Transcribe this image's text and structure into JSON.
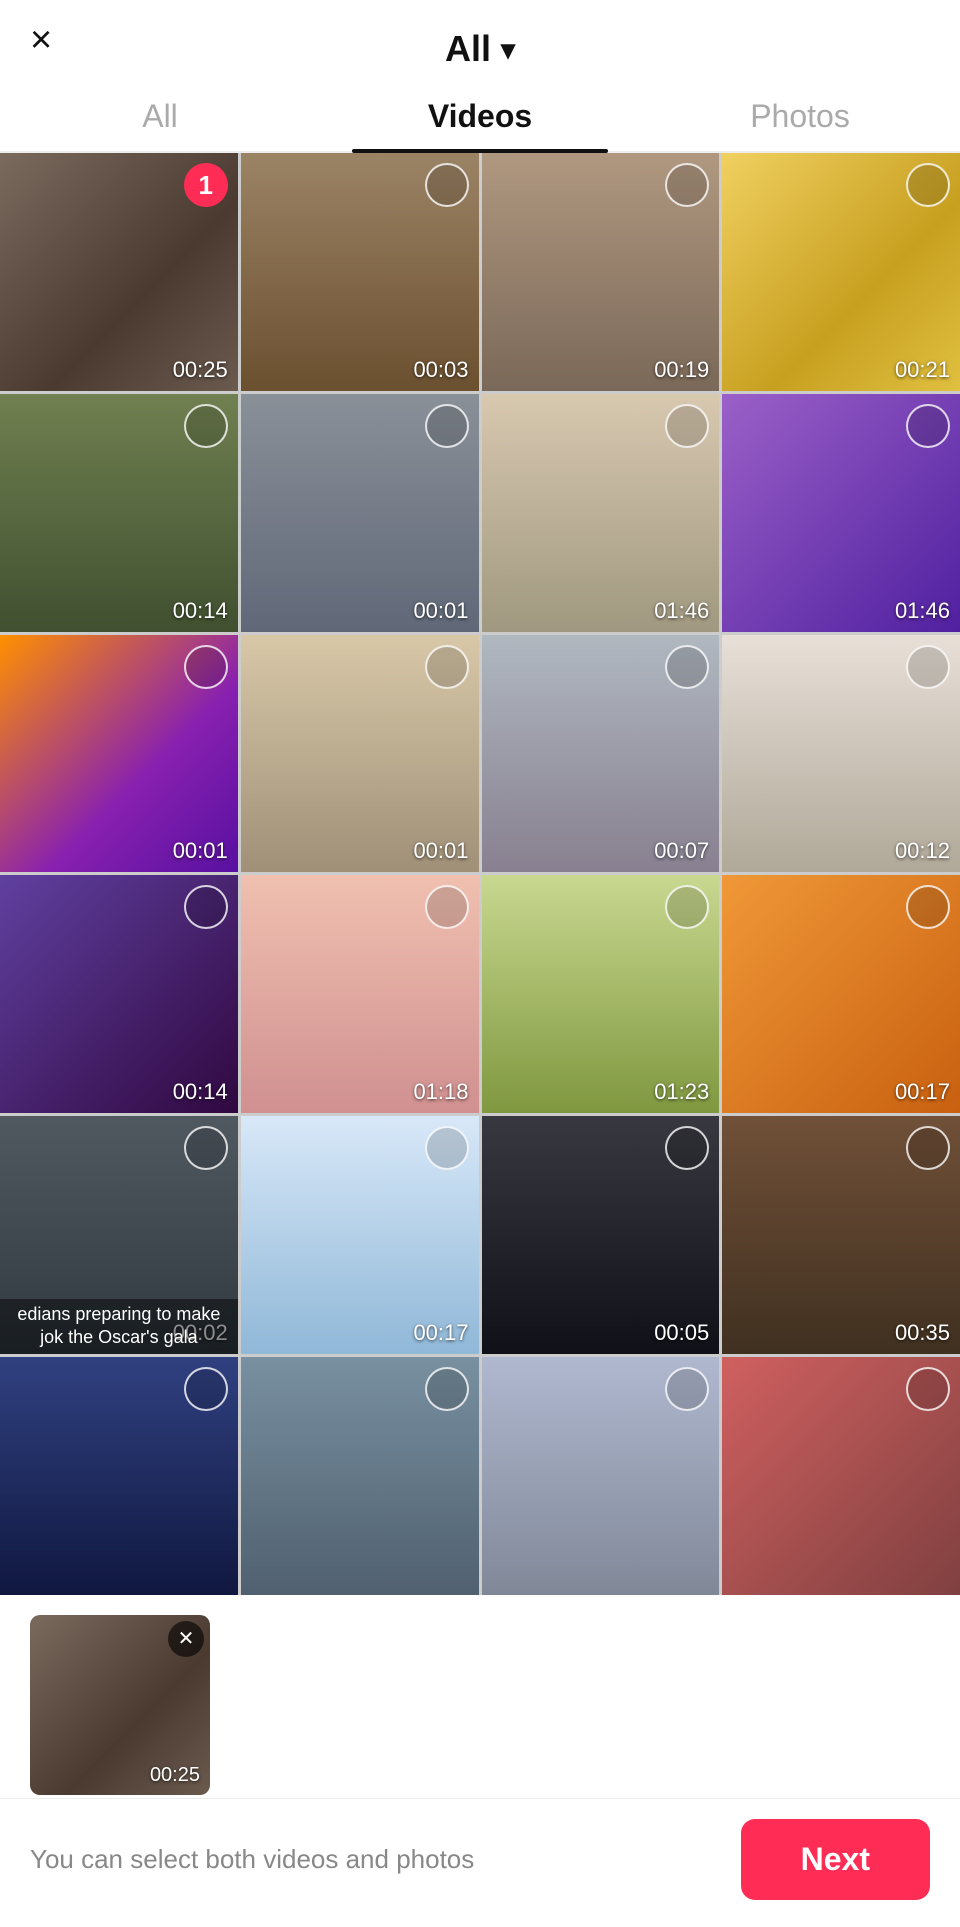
{
  "header": {
    "close_label": "×",
    "title": "All",
    "chevron": "▾"
  },
  "tabs": [
    {
      "id": "all",
      "label": "All",
      "active": false
    },
    {
      "id": "videos",
      "label": "Videos",
      "active": true
    },
    {
      "id": "photos",
      "label": "Photos",
      "active": false
    }
  ],
  "grid": {
    "items": [
      {
        "id": 1,
        "duration": "00:25",
        "color": "#6b5a4e",
        "selected": true,
        "badge": 1,
        "caption": ""
      },
      {
        "id": 2,
        "duration": "00:03",
        "color": "#8b7355",
        "selected": false,
        "caption": ""
      },
      {
        "id": 3,
        "duration": "00:19",
        "color": "#9e8c7a",
        "selected": false,
        "caption": ""
      },
      {
        "id": 4,
        "duration": "00:21",
        "color": "#e8c84a",
        "selected": false,
        "caption": ""
      },
      {
        "id": 5,
        "duration": "00:14",
        "color": "#6a7a4a",
        "selected": false,
        "caption": ""
      },
      {
        "id": 6,
        "duration": "00:01",
        "color": "#7a8090",
        "selected": false,
        "caption": ""
      },
      {
        "id": 7,
        "duration": "01:46",
        "color": "#c8b8a0",
        "selected": false,
        "caption": ""
      },
      {
        "id": 8,
        "duration": "01:46",
        "color": "#7b4fa0",
        "selected": false,
        "caption": ""
      },
      {
        "id": 9,
        "duration": "00:01",
        "color": "#8030b0",
        "selected": false,
        "caption": ""
      },
      {
        "id": 10,
        "duration": "00:01",
        "color": "#c8b098",
        "selected": false,
        "caption": ""
      },
      {
        "id": 11,
        "duration": "00:07",
        "color": "#a0a8b0",
        "selected": false,
        "caption": ""
      },
      {
        "id": 12,
        "duration": "00:12",
        "color": "#d8d0c8",
        "selected": false,
        "caption": ""
      },
      {
        "id": 13,
        "duration": "00:14",
        "color": "#503058",
        "selected": false,
        "caption": ""
      },
      {
        "id": 14,
        "duration": "01:18",
        "color": "#e0b0a8",
        "selected": false,
        "caption": ""
      },
      {
        "id": 15,
        "duration": "01:23",
        "color": "#b8c870",
        "selected": false,
        "caption": ""
      },
      {
        "id": 16,
        "duration": "00:17",
        "color": "#e88030",
        "selected": false,
        "caption": ""
      },
      {
        "id": 17,
        "duration": "00:02",
        "color": "#404850",
        "selected": false,
        "caption": "edians preparing to make jok\nthe Oscar's gala"
      },
      {
        "id": 18,
        "duration": "00:17",
        "color": "#c8d8f0",
        "selected": false,
        "caption": ""
      },
      {
        "id": 19,
        "duration": "00:05",
        "color": "#282830",
        "selected": false,
        "caption": ""
      },
      {
        "id": 20,
        "duration": "00:35",
        "color": "#604830",
        "selected": false,
        "caption": ""
      },
      {
        "id": 21,
        "duration": "",
        "color": "#283060",
        "selected": false,
        "caption": ""
      },
      {
        "id": 22,
        "duration": "",
        "color": "#708090",
        "selected": false,
        "caption": ""
      },
      {
        "id": 23,
        "duration": "",
        "color": "#a0a8c8",
        "selected": false,
        "caption": ""
      },
      {
        "id": 24,
        "duration": "",
        "color": "#c05050",
        "selected": false,
        "caption": ""
      }
    ]
  },
  "preview": {
    "show": true,
    "color": "#6b5a4e",
    "duration": "00:25"
  },
  "bottom": {
    "hint": "You can select both videos and photos",
    "next_label": "Next"
  }
}
